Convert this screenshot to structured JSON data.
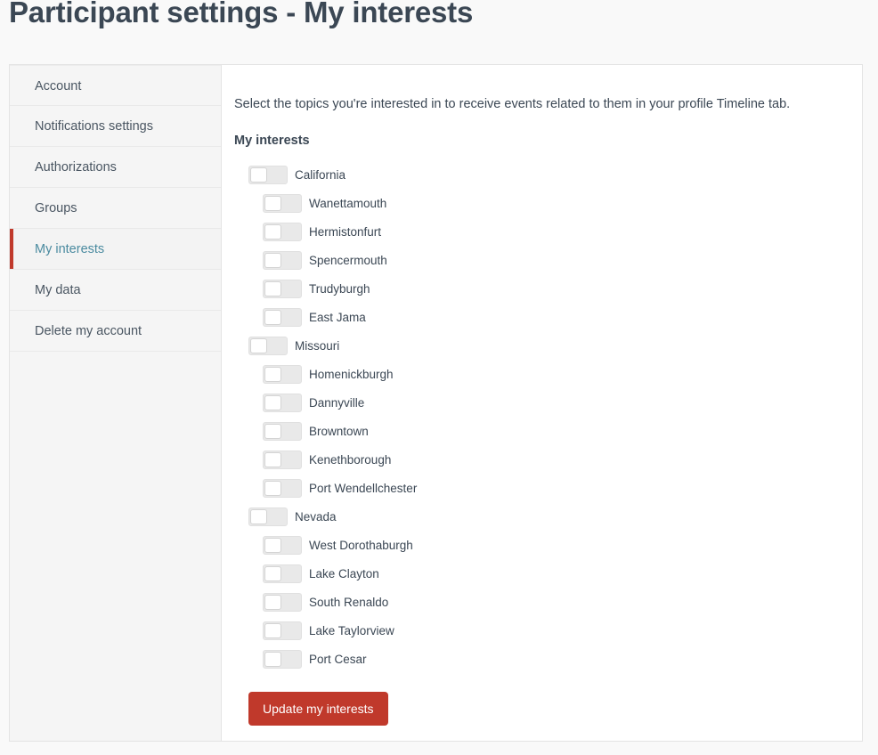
{
  "page": {
    "title": "Participant settings - My interests"
  },
  "sidebar": {
    "items": [
      {
        "label": "Account",
        "active": false
      },
      {
        "label": "Notifications settings",
        "active": false
      },
      {
        "label": "Authorizations",
        "active": false
      },
      {
        "label": "Groups",
        "active": false
      },
      {
        "label": "My interests",
        "active": true
      },
      {
        "label": "My data",
        "active": false
      },
      {
        "label": "Delete my account",
        "active": false
      }
    ]
  },
  "content": {
    "intro": "Select the topics you're interested in to receive events related to them in your profile Timeline tab.",
    "section_label": "My interests",
    "interests": [
      {
        "label": "California",
        "level": "parent",
        "on": false
      },
      {
        "label": "Wanettamouth",
        "level": "child",
        "on": false
      },
      {
        "label": "Hermistonfurt",
        "level": "child",
        "on": false
      },
      {
        "label": "Spencermouth",
        "level": "child",
        "on": false
      },
      {
        "label": "Trudyburgh",
        "level": "child",
        "on": false
      },
      {
        "label": "East Jama",
        "level": "child",
        "on": false
      },
      {
        "label": "Missouri",
        "level": "parent",
        "on": false
      },
      {
        "label": "Homenickburgh",
        "level": "child",
        "on": false
      },
      {
        "label": "Dannyville",
        "level": "child",
        "on": false
      },
      {
        "label": "Browntown",
        "level": "child",
        "on": false
      },
      {
        "label": "Kenethborough",
        "level": "child",
        "on": false
      },
      {
        "label": "Port Wendellchester",
        "level": "child",
        "on": false
      },
      {
        "label": "Nevada",
        "level": "parent",
        "on": false
      },
      {
        "label": "West Dorothaburgh",
        "level": "child",
        "on": false
      },
      {
        "label": "Lake Clayton",
        "level": "child",
        "on": false
      },
      {
        "label": "South Renaldo",
        "level": "child",
        "on": false
      },
      {
        "label": "Lake Taylorview",
        "level": "child",
        "on": false
      },
      {
        "label": "Port Cesar",
        "level": "child",
        "on": false
      }
    ],
    "submit_label": "Update my interests"
  },
  "colors": {
    "accent_red": "#c0392b",
    "active_link": "#4b8ba0",
    "text": "#3b4754",
    "sidebar_bg": "#f5f5f5",
    "page_bg": "#f9f9f9"
  }
}
